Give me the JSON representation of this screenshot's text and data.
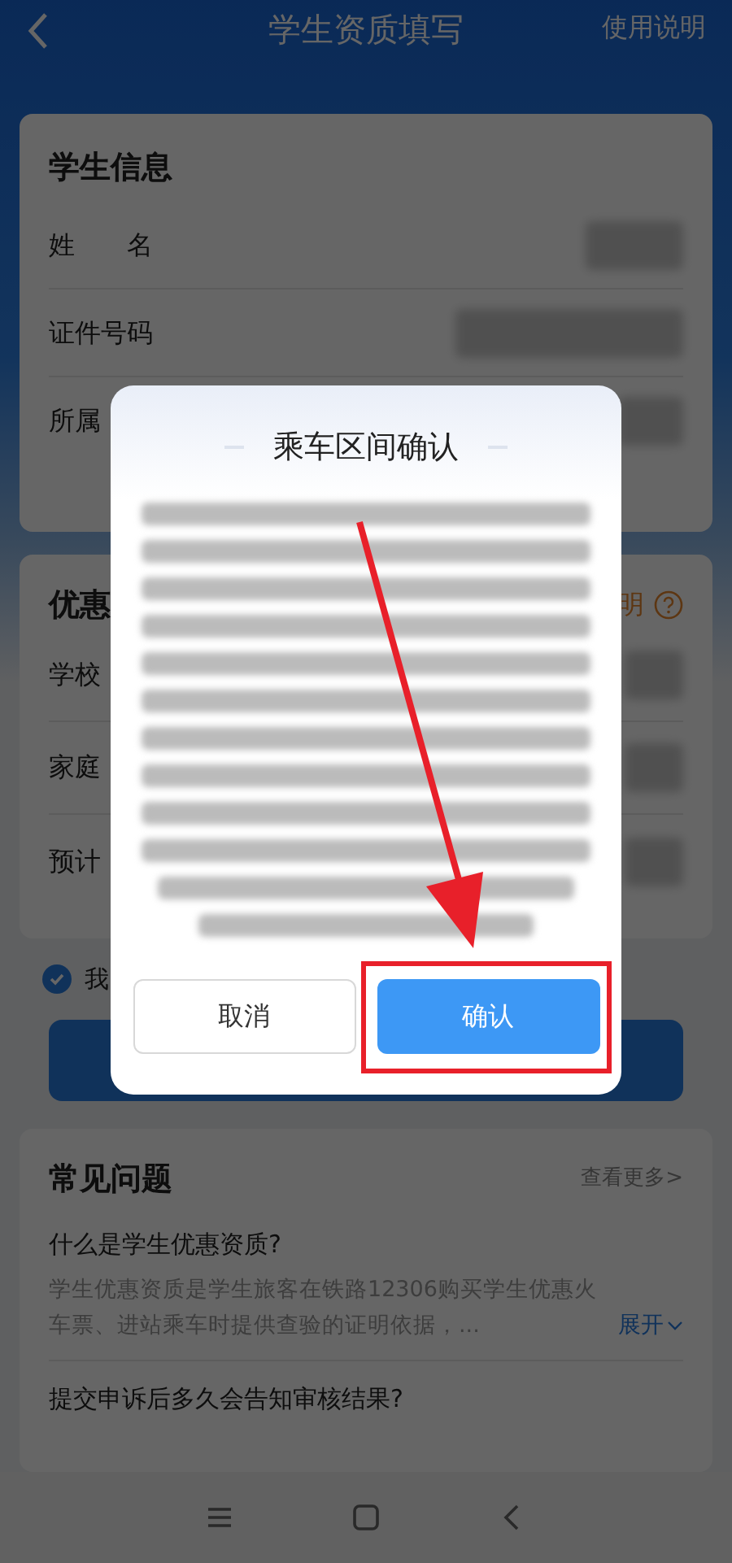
{
  "header": {
    "title": "学生资质填写",
    "action": "使用说明"
  },
  "student_info": {
    "title": "学生信息",
    "rows": [
      {
        "label": "姓　　名"
      },
      {
        "label": "证件号码"
      },
      {
        "label": "所属"
      }
    ]
  },
  "discount": {
    "title": "优惠",
    "help_link": "明",
    "rows": [
      {
        "label": "学校"
      },
      {
        "label": "家庭"
      },
      {
        "label": "预计"
      }
    ]
  },
  "agreement": {
    "checked": true,
    "text": "我"
  },
  "faq": {
    "title": "常见问题",
    "more": "查看更多>",
    "items": [
      {
        "question": "什么是学生优惠资质?",
        "answer": "学生优惠资质是学生旅客在铁路12306购买学生优惠火车票、进站乘车时提供查验的证明依据，...",
        "expand": "展开"
      },
      {
        "question": "提交申诉后多久会告知审核结果?"
      }
    ]
  },
  "dialog": {
    "title": "乘车区间确认",
    "buttons": [
      {
        "label": "取消",
        "kind": "secondary",
        "highlighted": false
      },
      {
        "label": "确认",
        "kind": "primary",
        "highlighted": true
      }
    ]
  }
}
